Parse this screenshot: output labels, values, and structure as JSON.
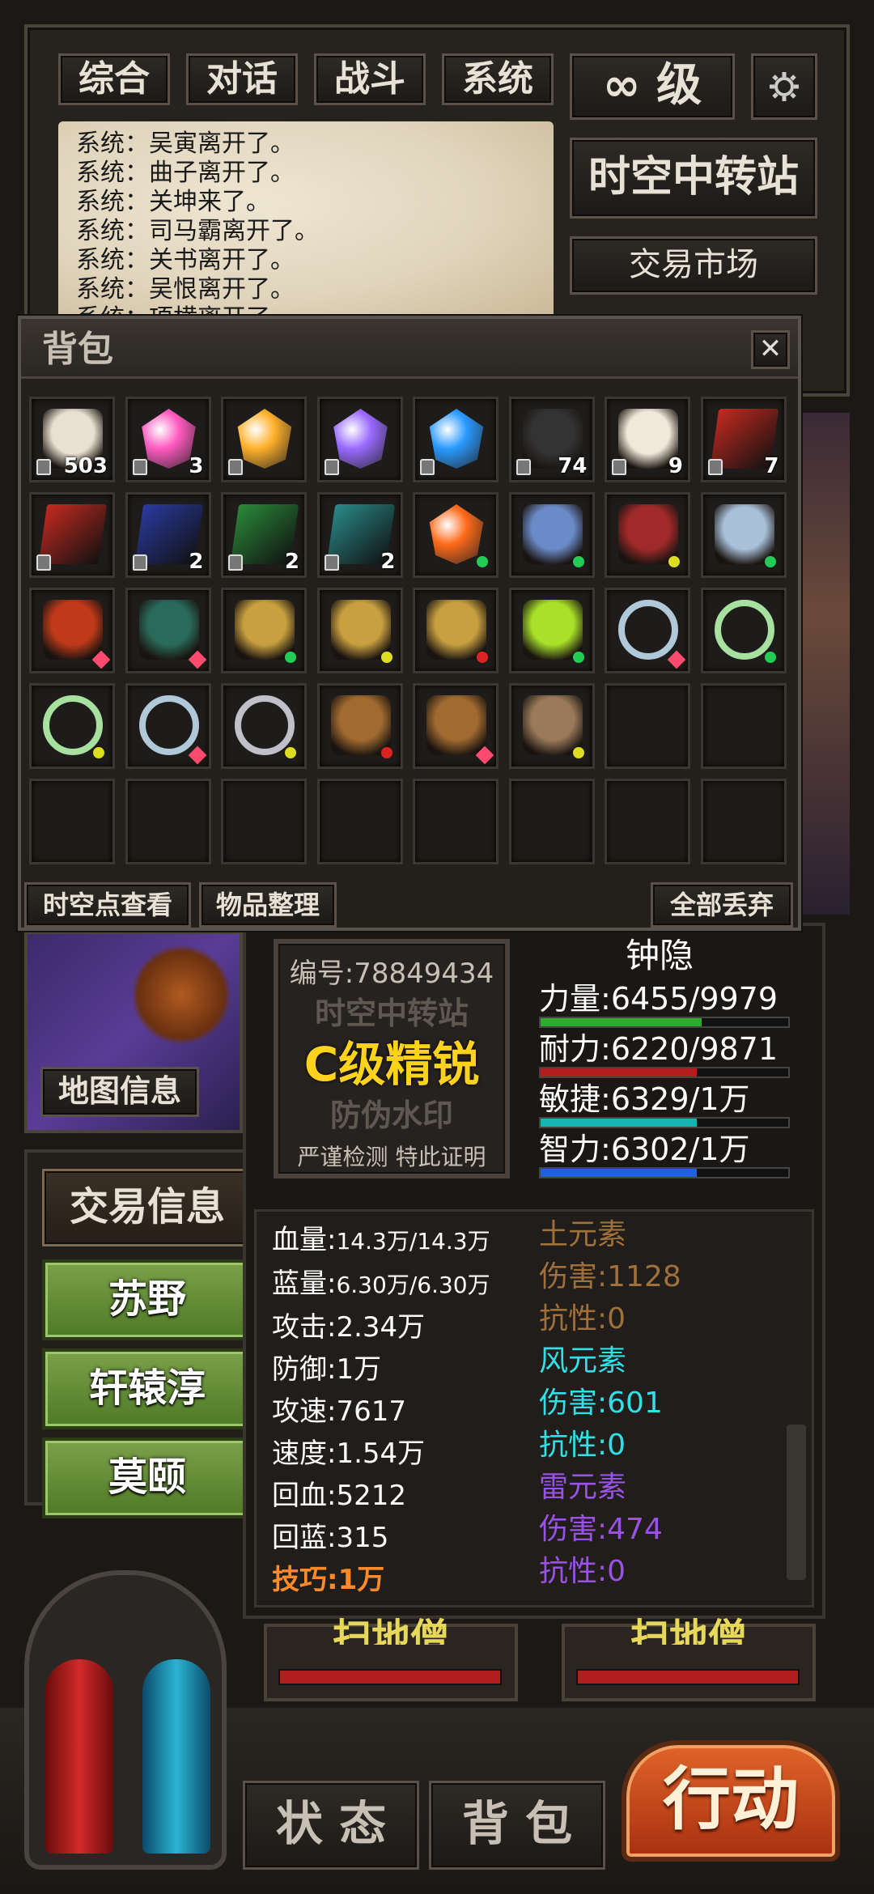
{
  "tabs": [
    "综合",
    "对话",
    "战斗",
    "系统"
  ],
  "level": {
    "symbol": "∞",
    "unit": "级"
  },
  "settings_icon": "gear-icon",
  "location_title": "时空中转站",
  "market_button": "交易市场",
  "chat_log": [
    "系统：吴寅离开了。",
    "系统：曲子离开了。",
    "系统：关坤来了。",
    "系统：司马霸离开了。",
    "系统：关书离开了。",
    "系统：吴恨离开了。",
    "系统：项横离开了。"
  ],
  "backpack": {
    "title": "背包",
    "close_icon": "close-icon",
    "items": [
      {
        "icon": "feed-bag-icon",
        "count": "503",
        "locked": true
      },
      {
        "icon": "pink-crystal-icon",
        "count": "3",
        "locked": true
      },
      {
        "icon": "orange-crystal-icon",
        "count": "",
        "locked": true
      },
      {
        "icon": "purple-crystal-icon",
        "count": "",
        "locked": true
      },
      {
        "icon": "blue-crystal-icon",
        "count": "",
        "locked": true
      },
      {
        "icon": "camera-icon",
        "count": "74",
        "locked": true
      },
      {
        "icon": "dog-food-bag-icon",
        "count": "9",
        "locked": true
      },
      {
        "icon": "red-book-icon",
        "count": "7",
        "locked": true
      },
      {
        "icon": "red-book-icon",
        "count": "",
        "locked": true
      },
      {
        "icon": "blue-book-icon",
        "count": "2",
        "locked": true
      },
      {
        "icon": "green-book-icon",
        "count": "2",
        "locked": true
      },
      {
        "icon": "teal-book-icon",
        "count": "2",
        "locked": true
      },
      {
        "icon": "orange-gem-icon",
        "count": "",
        "dot": "#22cc55"
      },
      {
        "icon": "blue-armor-icon",
        "count": "",
        "dot": "#22cc55"
      },
      {
        "icon": "red-armor-icon",
        "count": "",
        "dot": "#dddd22"
      },
      {
        "icon": "ghost-costume-icon",
        "count": "",
        "dot": "#22cc55"
      },
      {
        "icon": "red-gold-armor-icon",
        "count": "",
        "gem": true
      },
      {
        "icon": "green-helmet-icon",
        "count": "",
        "gem": true
      },
      {
        "icon": "gold-crown-icon",
        "count": "",
        "dot": "#22cc55"
      },
      {
        "icon": "gold-crown-icon",
        "count": "",
        "dot": "#dddd22"
      },
      {
        "icon": "gold-crown-icon",
        "count": "",
        "dot": "#dd2222"
      },
      {
        "icon": "green-blade-icon",
        "count": "",
        "dot": "#22cc55"
      },
      {
        "icon": "silver-bracelet-icon",
        "count": "",
        "gem": true
      },
      {
        "icon": "jade-necklace-icon",
        "count": "",
        "dot": "#22cc55"
      },
      {
        "icon": "jade-necklace-icon",
        "count": "",
        "dot": "#dddd22"
      },
      {
        "icon": "silver-bracelet-icon",
        "count": "",
        "gem": true
      },
      {
        "icon": "ruby-ring-icon",
        "count": "",
        "dot": "#dddd22"
      },
      {
        "icon": "bronze-helmet-icon",
        "count": "",
        "dot": "#dd2222"
      },
      {
        "icon": "bronze-helmet-icon",
        "count": "",
        "gem": true
      },
      {
        "icon": "leather-belt-icon",
        "count": "",
        "dot": "#dddd22"
      }
    ],
    "view_points_button": "时空点查看",
    "sort_button": "物品整理",
    "discard_all_button": "全部丢弃"
  },
  "map_info_button": "地图信息",
  "left_menu": {
    "trade_info": "交易信息",
    "npcs": [
      "苏野",
      "轩辕淳",
      "莫颐"
    ]
  },
  "certificate": {
    "id_label": "编号:",
    "id_value": "78849434",
    "watermark_top": "时空中转站",
    "grade": "C级精锐",
    "watermark_bottom": "防伪水印",
    "footer": "严谨检测 特此证明"
  },
  "character": {
    "name": "钟隐",
    "stats": [
      {
        "label": "力量:",
        "value": "6455/9979",
        "fill": 0.65,
        "color": "#2eaa2e"
      },
      {
        "label": "耐力:",
        "value": "6220/9871",
        "fill": 0.63,
        "color": "#b01e1e"
      },
      {
        "label": "敏捷:",
        "value": "6329/1万",
        "fill": 0.63,
        "color": "#1ab3b3"
      },
      {
        "label": "智力:",
        "value": "6302/1万",
        "fill": 0.63,
        "color": "#2060d8"
      }
    ],
    "attributes": [
      {
        "label": "血量:",
        "value": "14.3万/14.3万"
      },
      {
        "label": "蓝量:",
        "value": "6.30万/6.30万"
      },
      {
        "label": "攻击:",
        "value": "2.34万"
      },
      {
        "label": "防御:",
        "value": "1万"
      },
      {
        "label": "攻速:",
        "value": "7617"
      },
      {
        "label": "速度:",
        "value": "1.54万"
      },
      {
        "label": "回血:",
        "value": "5212"
      },
      {
        "label": "回蓝:",
        "value": "315"
      }
    ],
    "skill": {
      "label": "技巧:",
      "value": "1万"
    },
    "elements": [
      {
        "text": "土元素",
        "color": "#a0703a"
      },
      {
        "text": "伤害:1128",
        "color": "#a0703a"
      },
      {
        "text": "抗性:0",
        "color": "#a0703a"
      },
      {
        "text": "风元素",
        "color": "#30e0e8"
      },
      {
        "text": "伤害:601",
        "color": "#30e0e8"
      },
      {
        "text": "抗性:0",
        "color": "#30e0e8"
      },
      {
        "text": "雷元素",
        "color": "#9a52e6"
      },
      {
        "text": "伤害:474",
        "color": "#9a52e6"
      },
      {
        "text": "抗性:0",
        "color": "#9a52e6"
      }
    ]
  },
  "sweeper_buttons": [
    "扫地僧",
    "扫地僧"
  ],
  "bottom_nav": {
    "status": "状 态",
    "bag": "背 包",
    "action": "行动"
  }
}
